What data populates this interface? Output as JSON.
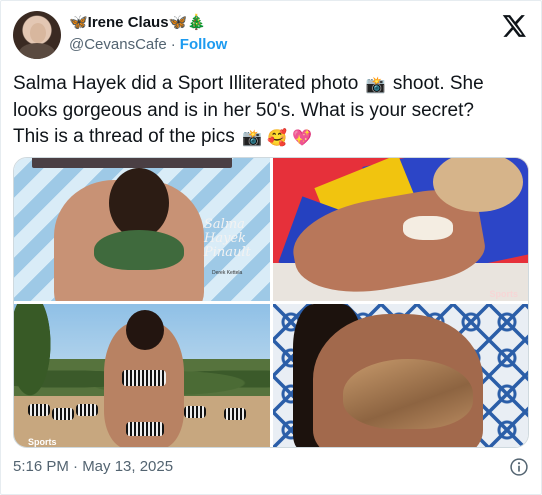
{
  "author": {
    "display_name": "🦋Irene Claus🦋🎄",
    "handle": "@CevansCafe",
    "separator": "·",
    "follow_label": "Follow"
  },
  "tweet": {
    "line1": "Salma Hayek did a Sport Illiterated photo",
    "line1_emoji": "📸",
    "line1_rest": "shoot. She",
    "line2": "looks gorgeous and is in her 50's. What is your secret?",
    "line3": "This is a thread of the pics",
    "line3_emojis": "📸 🥰 💖"
  },
  "media": {
    "photo1_cover_text": "Salma Hayek Pinault",
    "photo1_credit": "Derek Kettela",
    "photo2_logo": "Sports",
    "photo3_logo": "Sports"
  },
  "footer": {
    "timestamp": "5:16 PM · May 13, 2025"
  },
  "icons": {
    "brand": "x-logo-icon",
    "info": "info-icon"
  },
  "colors": {
    "link": "#1d9bf0",
    "muted": "#536471",
    "text": "#0f1419"
  }
}
